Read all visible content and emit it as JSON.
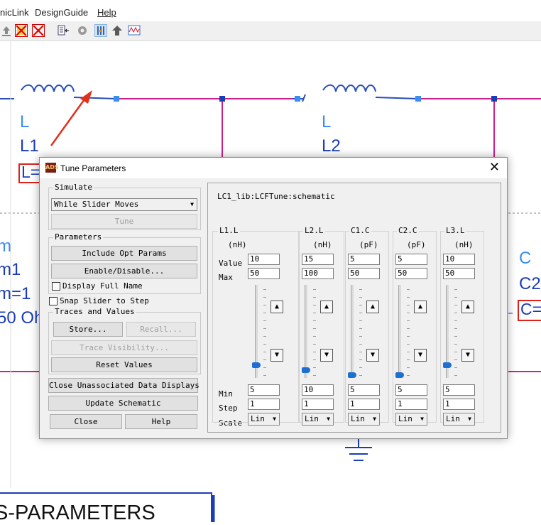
{
  "menu": [
    "nicLink",
    "DesignGuide",
    "Help"
  ],
  "toolbar_icons": [
    "export-icon",
    "deactivate-icon",
    "short-icon",
    "simulate-setup-icon",
    "gear-icon",
    "tune-icon",
    "push-up-icon",
    "waveform-icon"
  ],
  "schematic": {
    "l1_type": "L",
    "l1_name": "L1",
    "l1_param": "L=",
    "l2_type": "L",
    "l2_name": "L2",
    "c2_type": "C",
    "c2_name": "C2",
    "c2_param": "C=",
    "term_type": "m",
    "term_name": "m1",
    "term_num": "m=1",
    "term_z": "50 Oh",
    "sparams_label": "S-PARAMETERS"
  },
  "dialog": {
    "title": "Tune Parameters",
    "close_glyph": "✕",
    "simulate": {
      "group_title": "Simulate",
      "mode": "While Slider Moves",
      "tune_btn": "Tune"
    },
    "parameters": {
      "group_title": "Parameters",
      "include_opt": "Include Opt Params",
      "enable_disable": "Enable/Disable...",
      "display_full_name": "Display Full Name"
    },
    "snap_slider": "Snap Slider to Step",
    "traces": {
      "group_title": "Traces and Values",
      "store": "Store...",
      "recall": "Recall...",
      "trace_visibility": "Trace Visibility...",
      "reset_values": "Reset Values"
    },
    "close_unassociated": "Close Unassociated Data Displays",
    "update_schematic": "Update Schematic",
    "close_btn": "Close",
    "help_btn": "Help",
    "schematic_path": "LC1_lib:LCFTune:schematic",
    "row_labels": {
      "value": "Value",
      "max": "Max",
      "min": "Min",
      "step": "Step",
      "scale": "Scale"
    },
    "params": [
      {
        "name": "L1.L",
        "unit": "(nH)",
        "value": "10",
        "max": "50",
        "min": "5",
        "step": "1",
        "scale": "Lin",
        "position": 0.11
      },
      {
        "name": "L2.L",
        "unit": "(nH)",
        "value": "15",
        "max": "100",
        "min": "10",
        "step": "1",
        "scale": "Lin",
        "position": 0.06
      },
      {
        "name": "C1.C",
        "unit": "(pF)",
        "value": "5",
        "max": "50",
        "min": "5",
        "step": "1",
        "scale": "Lin",
        "position": 0.0
      },
      {
        "name": "C2.C",
        "unit": "(pF)",
        "value": "5",
        "max": "50",
        "min": "5",
        "step": "1",
        "scale": "Lin",
        "position": 0.0
      },
      {
        "name": "L3.L",
        "unit": "(nH)",
        "value": "10",
        "max": "50",
        "min": "5",
        "step": "1",
        "scale": "Lin",
        "position": 0.11
      }
    ]
  }
}
